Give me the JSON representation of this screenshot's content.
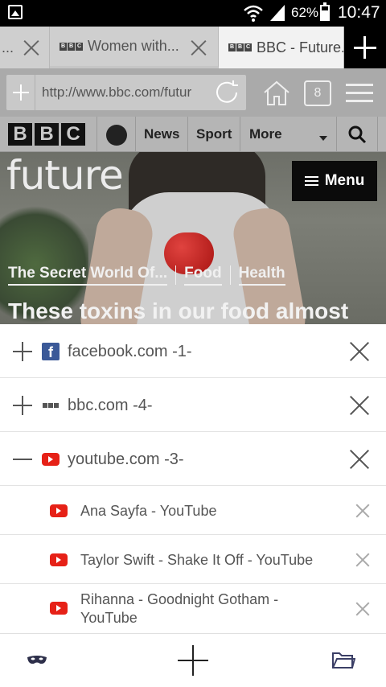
{
  "status_bar": {
    "battery_percent": "62%",
    "time": "10:47"
  },
  "tabs": [
    {
      "label": "...",
      "active": false
    },
    {
      "label": "Women with...",
      "active": false,
      "favicon": "bbc-icon"
    },
    {
      "label": "BBC - Future...",
      "active": true,
      "favicon": "bbc-icon"
    }
  ],
  "url_bar": {
    "url": "http://www.bbc.com/futur",
    "tab_count": "8"
  },
  "bbc_nav": {
    "logo_letters": [
      "B",
      "B",
      "C"
    ],
    "items": [
      "News",
      "Sport",
      "More"
    ]
  },
  "hero": {
    "site_title": "future",
    "menu_label": "Menu",
    "subnav": [
      "The Secret World Of...",
      "Food",
      "Health"
    ],
    "headline": "These toxins in our food almost"
  },
  "tab_groups": [
    {
      "label": "facebook.com -1-",
      "expanded": false,
      "icon": "facebook-icon"
    },
    {
      "label": "bbc.com -4-",
      "expanded": false,
      "icon": "bbc-icon"
    },
    {
      "label": "youtube.com -3-",
      "expanded": true,
      "icon": "youtube-icon",
      "tabs": [
        {
          "title": "Ana Sayfa - YouTube"
        },
        {
          "title": "Taylor Swift - Shake It Off - YouTube"
        },
        {
          "title_line1": "Rihanna - Goodnight Gotham -",
          "title_line2": "YouTube"
        }
      ]
    }
  ],
  "colors": {
    "facebook": "#3b5998",
    "youtube": "#e62117",
    "menu_bg": "#0b0b0b"
  }
}
